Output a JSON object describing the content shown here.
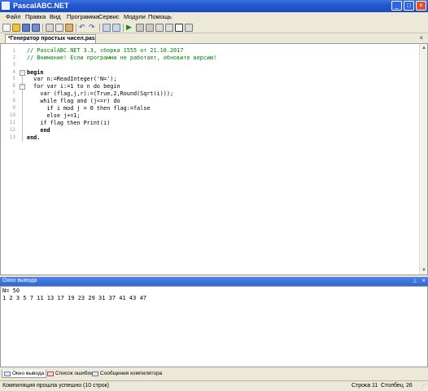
{
  "window": {
    "title": "PascalABC.NET"
  },
  "menu": [
    "Файл",
    "Правка",
    "Вид",
    "Программа",
    "Сервис",
    "Модули",
    "Помощь"
  ],
  "editor_tab": {
    "label": "*Генератор простых чисел.pas"
  },
  "code": [
    {
      "num": "1",
      "text": "// PascalABC.NET 3.3, сборка 1555 от 21.10.2017"
    },
    {
      "num": "2",
      "text": "// Внимание! Если программа не работает, обновите версию!"
    },
    {
      "num": "3",
      "text": ""
    },
    {
      "num": "4",
      "text": "begin"
    },
    {
      "num": "5",
      "text": "  var n:=ReadInteger('N=');"
    },
    {
      "num": "6",
      "text": "  for var i:=1 to n do begin"
    },
    {
      "num": "7",
      "text": "    var (flag,j,r):=(True,2,Round(Sqrt(i)));"
    },
    {
      "num": "8",
      "text": "    while flag and (j<=r) do"
    },
    {
      "num": "9",
      "text": "      if i mod j = 0 then flag:=false"
    },
    {
      "num": "10",
      "text": "      else j+=1;"
    },
    {
      "num": "11",
      "text": "    if flag then Print(i)"
    },
    {
      "num": "12",
      "text": "    end"
    },
    {
      "num": "13",
      "text": "end."
    }
  ],
  "output_panel": {
    "title": "Окно вывода",
    "lines": [
      "N= 50",
      "1 2 3 5 7 11 13 17 19 23 29 31 37 41 43 47"
    ]
  },
  "bottom_tabs": [
    "Окно вывода",
    "Список ошибок",
    "Сообщения компилятора"
  ],
  "status": {
    "message": "Компиляция прошла успешно (10 строк)",
    "row_label": "Строка",
    "row_value": "11",
    "col_label": "Столбец",
    "col_value": "26"
  }
}
